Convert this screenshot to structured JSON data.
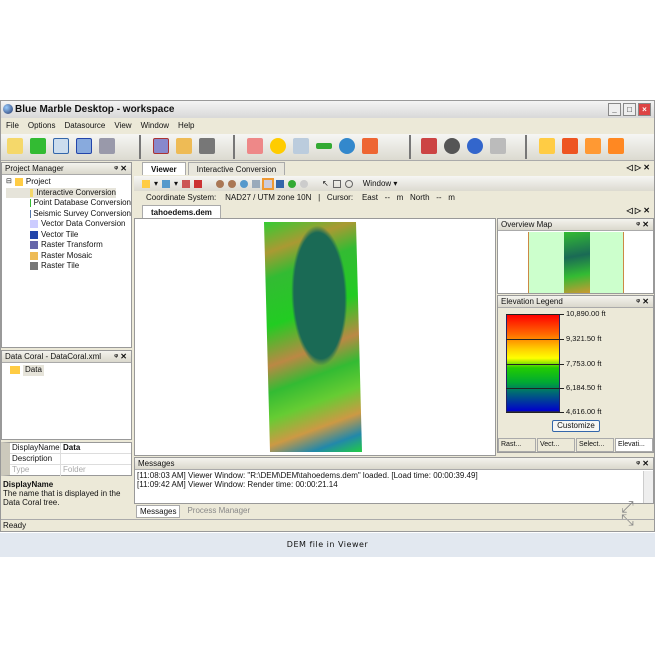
{
  "window": {
    "title": "Blue Marble Desktop - workspace"
  },
  "menu": [
    "File",
    "Options",
    "Datasource",
    "View",
    "Window",
    "Help"
  ],
  "project_manager": {
    "title": "Project Manager",
    "root": "Project",
    "items": [
      "Interactive Conversion",
      "Point Database Conversion",
      "Seismic Survey Conversion",
      "Vector Data Conversion",
      "Vector Tile",
      "Raster Transform",
      "Raster Mosaic",
      "Raster Tile"
    ]
  },
  "data_coral": {
    "title": "Data Coral - DataCoral.xml",
    "items": [
      "Data"
    ]
  },
  "properties": [
    {
      "name": "DisplayName",
      "value": "Data"
    },
    {
      "name": "Description",
      "value": ""
    },
    {
      "name": "Type",
      "value": "Folder"
    }
  ],
  "description": {
    "title": "DisplayName",
    "text": "The name that is displayed in the Data Coral tree."
  },
  "viewer": {
    "tabs": [
      "Viewer",
      "Interactive Conversion"
    ],
    "window_menu": "Window",
    "coord_label": "Coordinate System:",
    "coord_value": "NAD27 / UTM zone 10N",
    "cursor": "Cursor:",
    "east": "East",
    "east_val": "--",
    "east_unit": "m",
    "north": "North",
    "north_val": "--",
    "north_unit": "m",
    "doc_tab": "tahoedems.dem"
  },
  "overview": {
    "title": "Overview Map"
  },
  "legend": {
    "title": "Elevation Legend",
    "labels": [
      "10,890.00 ft",
      "9,321.50 ft",
      "7,753.00 ft",
      "6,184.50 ft",
      "4,616.00 ft"
    ],
    "button": "Customize",
    "tabs": [
      "Rast...",
      "Vect...",
      "Select...",
      "Elevati..."
    ]
  },
  "messages": {
    "title": "Messages",
    "lines": [
      "[11:08:03 AM] Viewer Window: \"R:\\DEM\\DEM\\tahoedems.dem\" loaded.  [Load time:  00:00:39.49]",
      "[11:09:42 AM] Viewer Window: Render time:  00:00:21.14"
    ],
    "tabs": [
      "Messages",
      "Process Manager"
    ]
  },
  "status": "Ready",
  "caption": "DEM file in Viewer"
}
